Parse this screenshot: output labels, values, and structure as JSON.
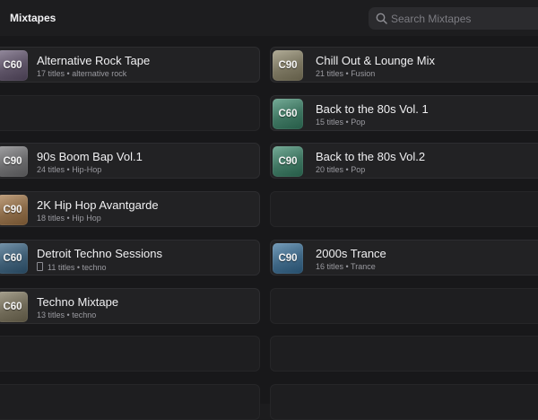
{
  "header": {
    "title": "Mixtapes",
    "search_placeholder": "Search Mixtapes"
  },
  "left_cards": [
    {
      "badge": "C60",
      "title": "Alternative Rock Tape",
      "count": "17 titles",
      "genre": "alternative rock",
      "color": "#5d5366"
    },
    null,
    {
      "badge": "C90",
      "title": "90s Boom Bap Vol.1",
      "count": "24 titles",
      "genre": "Hip-Hop",
      "color": "#6a6a6c"
    },
    {
      "badge": "C90",
      "title": "2K Hip Hop Avantgarde",
      "count": "18 titles",
      "genre": "Hip Hop",
      "color": "#8a6a48"
    },
    {
      "badge": "C60",
      "title": "Detroit Techno Sessions",
      "count": "11 titles",
      "genre": "techno",
      "color": "#3e5d74",
      "synced": true
    },
    {
      "badge": "C60",
      "title": "Techno Mixtape",
      "count": "13 titles",
      "genre": "techno",
      "color": "#706a58"
    },
    null,
    null
  ],
  "right_cards": [
    {
      "badge": "C90",
      "title": "Chill Out & Lounge Mix",
      "count": "21 titles",
      "genre": "Fusion",
      "color": "#7a7560"
    },
    {
      "badge": "C60",
      "title": "Back to the 80s Vol. 1",
      "count": "15 titles",
      "genre": "Pop",
      "color": "#3e7460"
    },
    {
      "badge": "C90",
      "title": "Back to the 80s Vol.2",
      "count": "20 titles",
      "genre": "Pop",
      "color": "#3e7460"
    },
    null,
    {
      "badge": "C90",
      "title": "2000s Trance",
      "count": "16 titles",
      "genre": "Trance",
      "color": "#3e6684"
    },
    null,
    null,
    null
  ],
  "separator": " • "
}
